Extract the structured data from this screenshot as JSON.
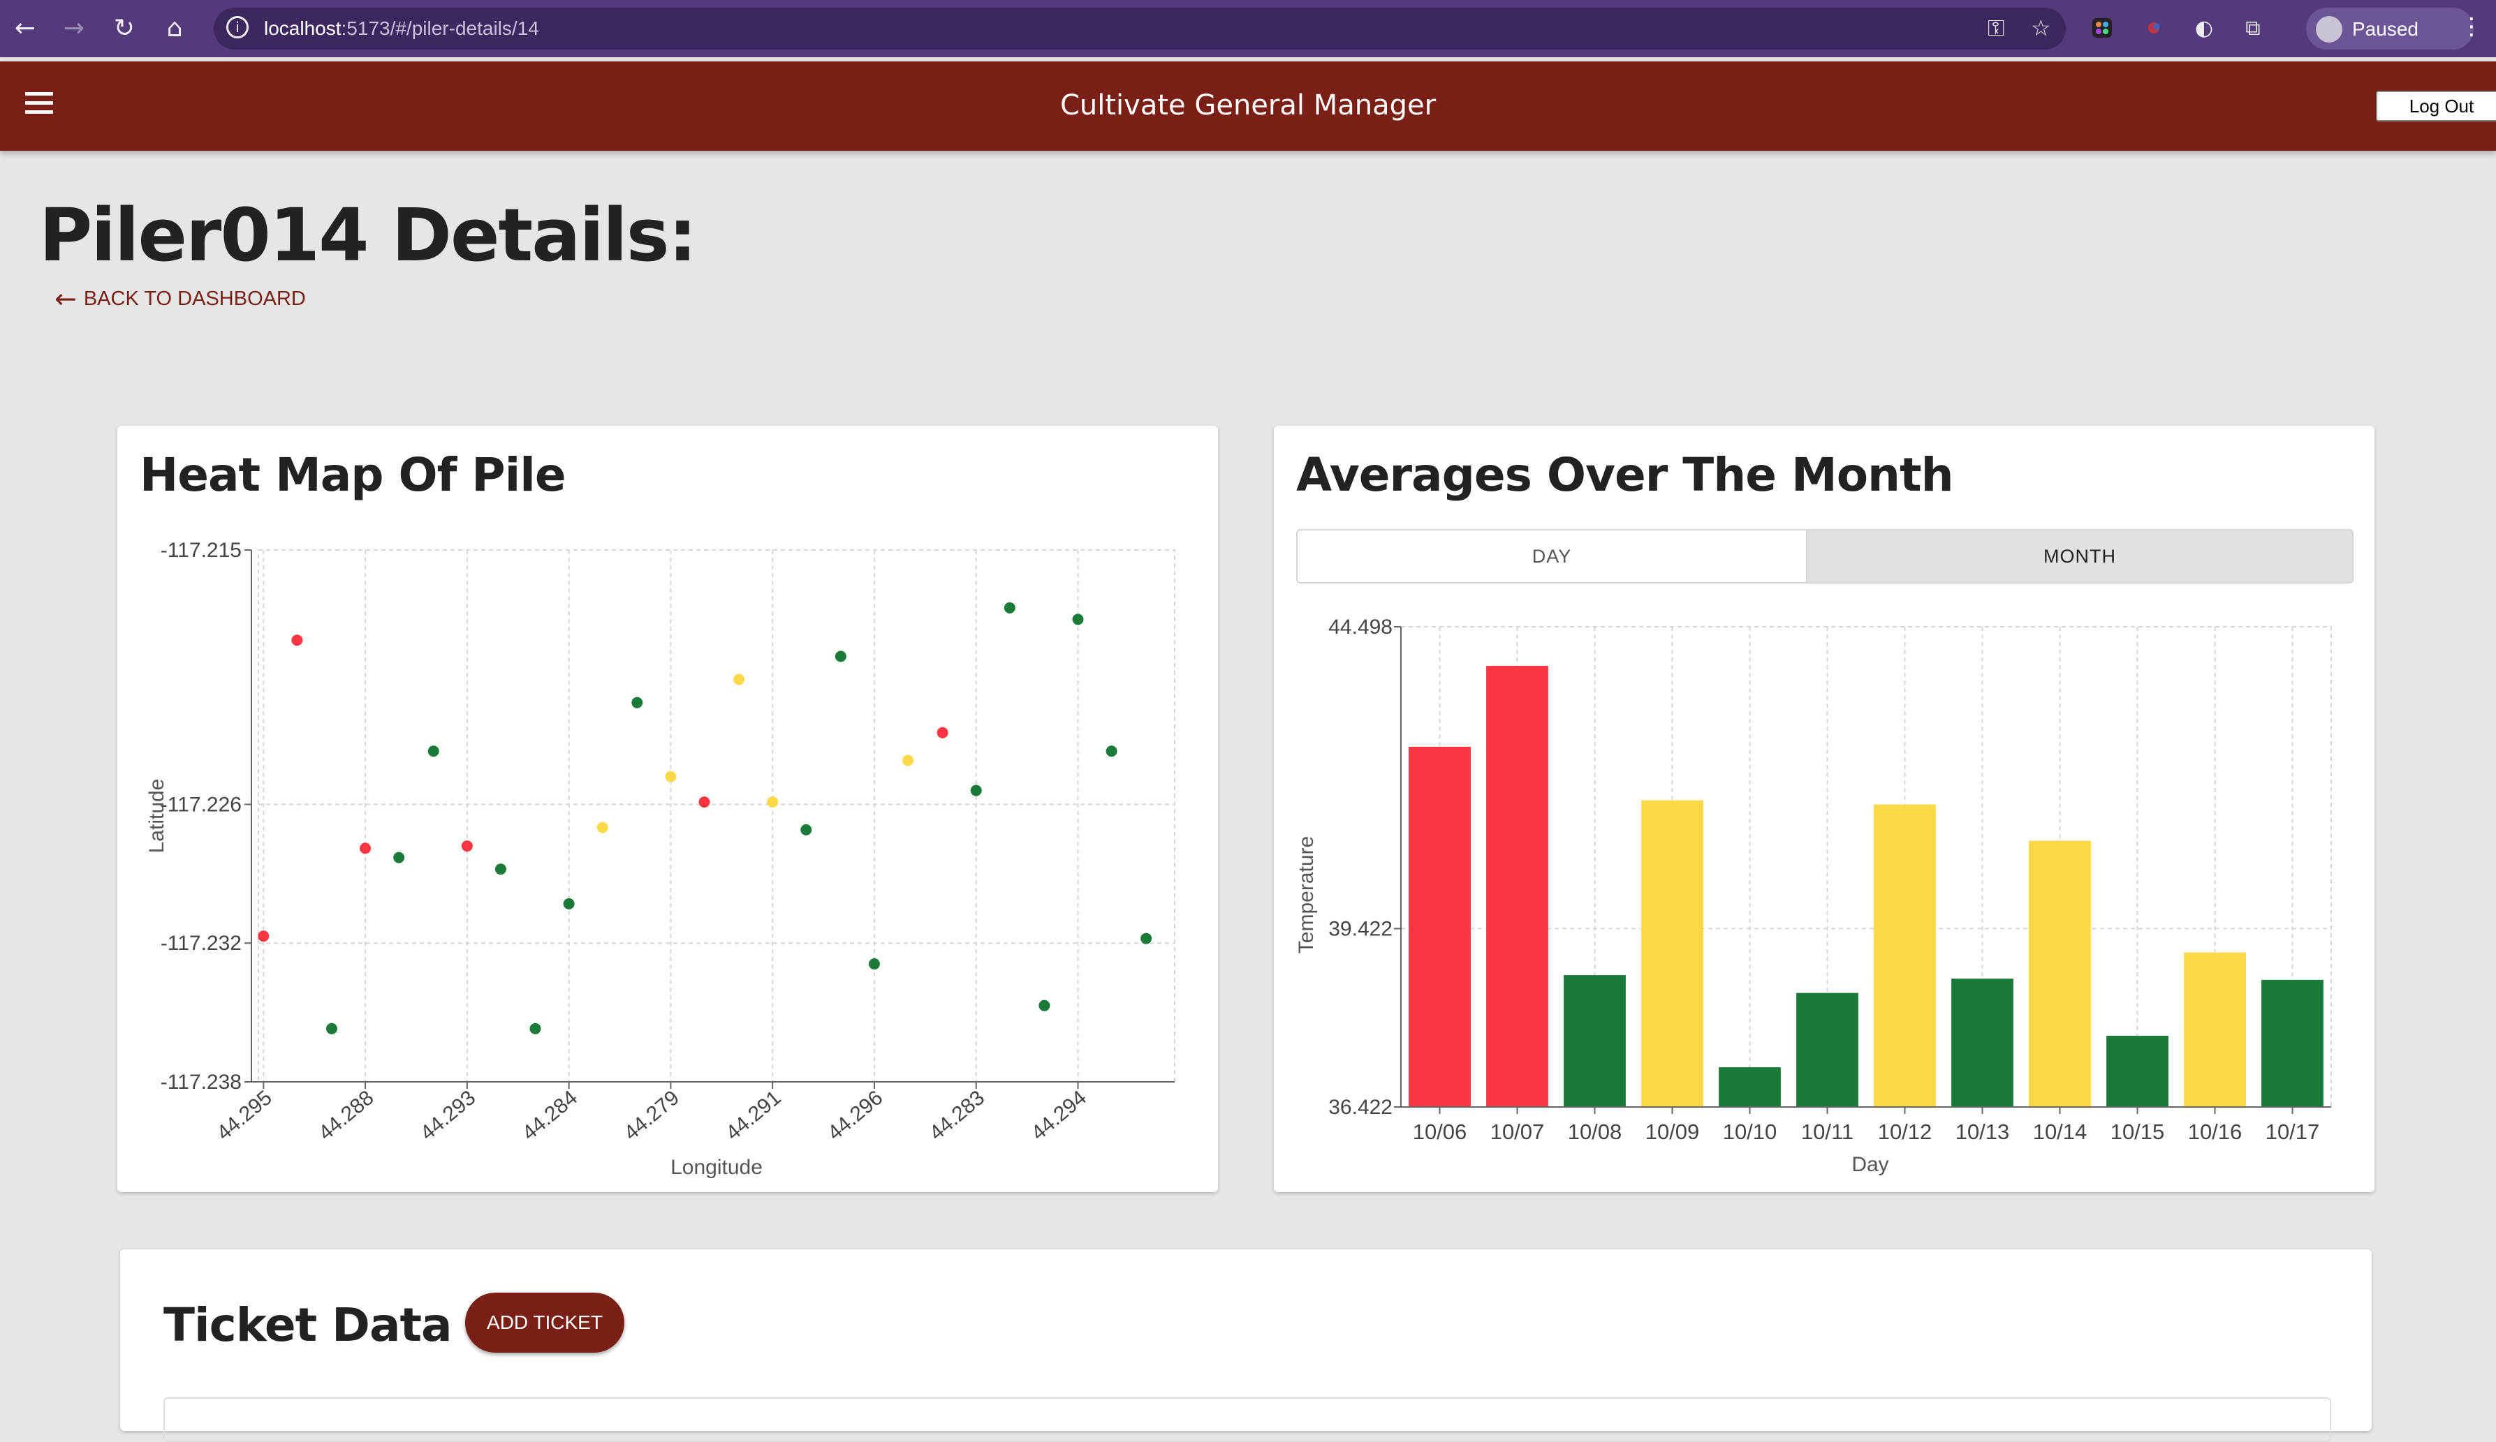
{
  "browser": {
    "url_host": "localhost",
    "url_path": ":5173/#/piler-details/14",
    "profile_label": "Paused"
  },
  "app": {
    "title": "Cultivate General Manager",
    "logout_label": "Log Out"
  },
  "page": {
    "title": "Piler014 Details:",
    "back_link": "BACK TO DASHBOARD"
  },
  "heatmap": {
    "title": "Heat Map Of Pile"
  },
  "averages": {
    "title": "Averages Over The Month",
    "toggle_day": "DAY",
    "toggle_month": "MONTH",
    "selected_toggle": "MONTH"
  },
  "tickets": {
    "title": "Ticket Data",
    "add_label": "ADD TICKET"
  },
  "colors": {
    "hot": "#fb3640",
    "warm": "#fdd848",
    "ok": "#1b7a3a",
    "brand": "#7a1f16",
    "browser": "#533b7b"
  },
  "chart_data": [
    {
      "type": "scatter",
      "xlabel": "Longitude",
      "ylabel": "Latitude",
      "x_tick_labels": [
        "44.295",
        "44.288",
        "44.293",
        "44.284",
        "44.279",
        "44.291",
        "44.296",
        "44.283",
        "44.294"
      ],
      "y_tick_labels": [
        "-117.215",
        "-117.226",
        "-117.232",
        "-117.238"
      ],
      "grid": true,
      "points": [
        {
          "i": 0,
          "y": -117.2317,
          "status": "hot"
        },
        {
          "i": 0.33,
          "y": -117.2189,
          "status": "hot"
        },
        {
          "i": 0.67,
          "y": -117.2357,
          "status": "ok"
        },
        {
          "i": 1,
          "y": -117.2279,
          "status": "hot"
        },
        {
          "i": 1.33,
          "y": -117.2283,
          "status": "ok"
        },
        {
          "i": 1.67,
          "y": -117.2237,
          "status": "ok"
        },
        {
          "i": 2,
          "y": -117.2278,
          "status": "hot"
        },
        {
          "i": 2.33,
          "y": -117.2288,
          "status": "ok"
        },
        {
          "i": 2.67,
          "y": -117.2357,
          "status": "ok"
        },
        {
          "i": 3,
          "y": -117.2303,
          "status": "ok"
        },
        {
          "i": 3.33,
          "y": -117.227,
          "status": "warm"
        },
        {
          "i": 3.67,
          "y": -117.2216,
          "status": "ok"
        },
        {
          "i": 4,
          "y": -117.2248,
          "status": "warm"
        },
        {
          "i": 4.33,
          "y": -117.2259,
          "status": "hot"
        },
        {
          "i": 4.67,
          "y": -117.2206,
          "status": "warm"
        },
        {
          "i": 5,
          "y": -117.2259,
          "status": "warm"
        },
        {
          "i": 5.33,
          "y": -117.2271,
          "status": "ok"
        },
        {
          "i": 5.67,
          "y": -117.2196,
          "status": "ok"
        },
        {
          "i": 6,
          "y": -117.2329,
          "status": "ok"
        },
        {
          "i": 6.33,
          "y": -117.2241,
          "status": "warm"
        },
        {
          "i": 6.67,
          "y": -117.2229,
          "status": "hot"
        },
        {
          "i": 7,
          "y": -117.2254,
          "status": "ok"
        },
        {
          "i": 7.33,
          "y": -117.2175,
          "status": "ok"
        },
        {
          "i": 7.67,
          "y": -117.2347,
          "status": "ok"
        },
        {
          "i": 8,
          "y": -117.218,
          "status": "ok"
        },
        {
          "i": 8.33,
          "y": -117.2237,
          "status": "ok"
        },
        {
          "i": 8.67,
          "y": -117.2318,
          "status": "ok"
        }
      ]
    },
    {
      "type": "bar",
      "xlabel": "Day",
      "ylabel": "Temperature",
      "ylim": [
        36.422,
        44.498
      ],
      "y_tick_labels": [
        "44.498",
        "39.422",
        "36.422"
      ],
      "categories": [
        "10/06",
        "10/07",
        "10/08",
        "10/09",
        "10/10",
        "10/11",
        "10/12",
        "10/13",
        "10/14",
        "10/15",
        "10/16",
        "10/17"
      ],
      "values": [
        42.48,
        43.84,
        38.64,
        41.58,
        37.09,
        38.34,
        41.51,
        38.58,
        40.9,
        37.62,
        39.02,
        38.56
      ],
      "statuses": [
        "hot",
        "hot",
        "ok",
        "warm",
        "ok",
        "ok",
        "warm",
        "ok",
        "warm",
        "ok",
        "warm",
        "ok"
      ],
      "grid": true
    }
  ]
}
